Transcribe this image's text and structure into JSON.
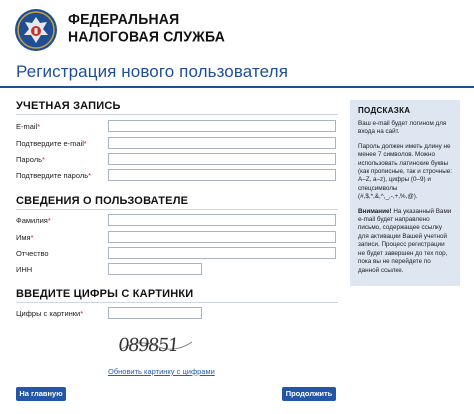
{
  "header": {
    "org_line1": "ФЕДЕРАЛЬНАЯ",
    "org_line2": "НАЛОГОВАЯ СЛУЖБА"
  },
  "page_title": "Регистрация нового пользователя",
  "account": {
    "title": "УЧЕТНАЯ ЗАПИСЬ",
    "fields": [
      {
        "label": "E-mail",
        "required": "*",
        "value": ""
      },
      {
        "label": "Подтвердите e-mail",
        "required": "*",
        "value": ""
      },
      {
        "label": "Пароль",
        "required": "*",
        "value": ""
      },
      {
        "label": "Подтвердите пароль",
        "required": "*",
        "value": ""
      }
    ]
  },
  "user": {
    "title": "СВЕДЕНИЯ О ПОЛЬЗОВАТЕЛЕ",
    "fields": [
      {
        "label": "Фамилия",
        "required": "*",
        "value": ""
      },
      {
        "label": "Имя",
        "required": "*",
        "value": ""
      },
      {
        "label": "Отчество",
        "required": "",
        "value": ""
      },
      {
        "label": "ИНН",
        "required": "",
        "value": ""
      }
    ]
  },
  "captcha": {
    "title": "ВВЕДИТЕ ЦИФРЫ С КАРТИНКИ",
    "label": "Цифры с картинки",
    "required": "*",
    "value": "",
    "image_text": "089851",
    "refresh_link": "Обновить картинку с цифрами"
  },
  "buttons": {
    "home": "На главную",
    "continue": "Продолжить"
  },
  "hint": {
    "title": "ПОДСКАЗКА",
    "p1": "Ваш e-mail будет логином для входа на сайт.",
    "p2": "Пароль должен иметь длину не менее 7 символов. Можно использовать латинские буквы (как прописные, так и строчные: A–Z, a–z), цифры (0–9) и спецсимволы (#,$,*,&,^,_,-,+,%,@).",
    "attention_label": "Внимание!",
    "p3": " На указанный Вами e-mail будет направлено письмо, содержащее ссылку для активации Вашей учетной записи. Процесс регистрации не будет завершен до тех пор, пока вы не перейдете по данной ссылке."
  },
  "colors": {
    "brand_blue": "#1f4e95",
    "button_blue": "#2356a7",
    "hint_bg": "#dde6f1",
    "required_red": "#d21b1b"
  }
}
